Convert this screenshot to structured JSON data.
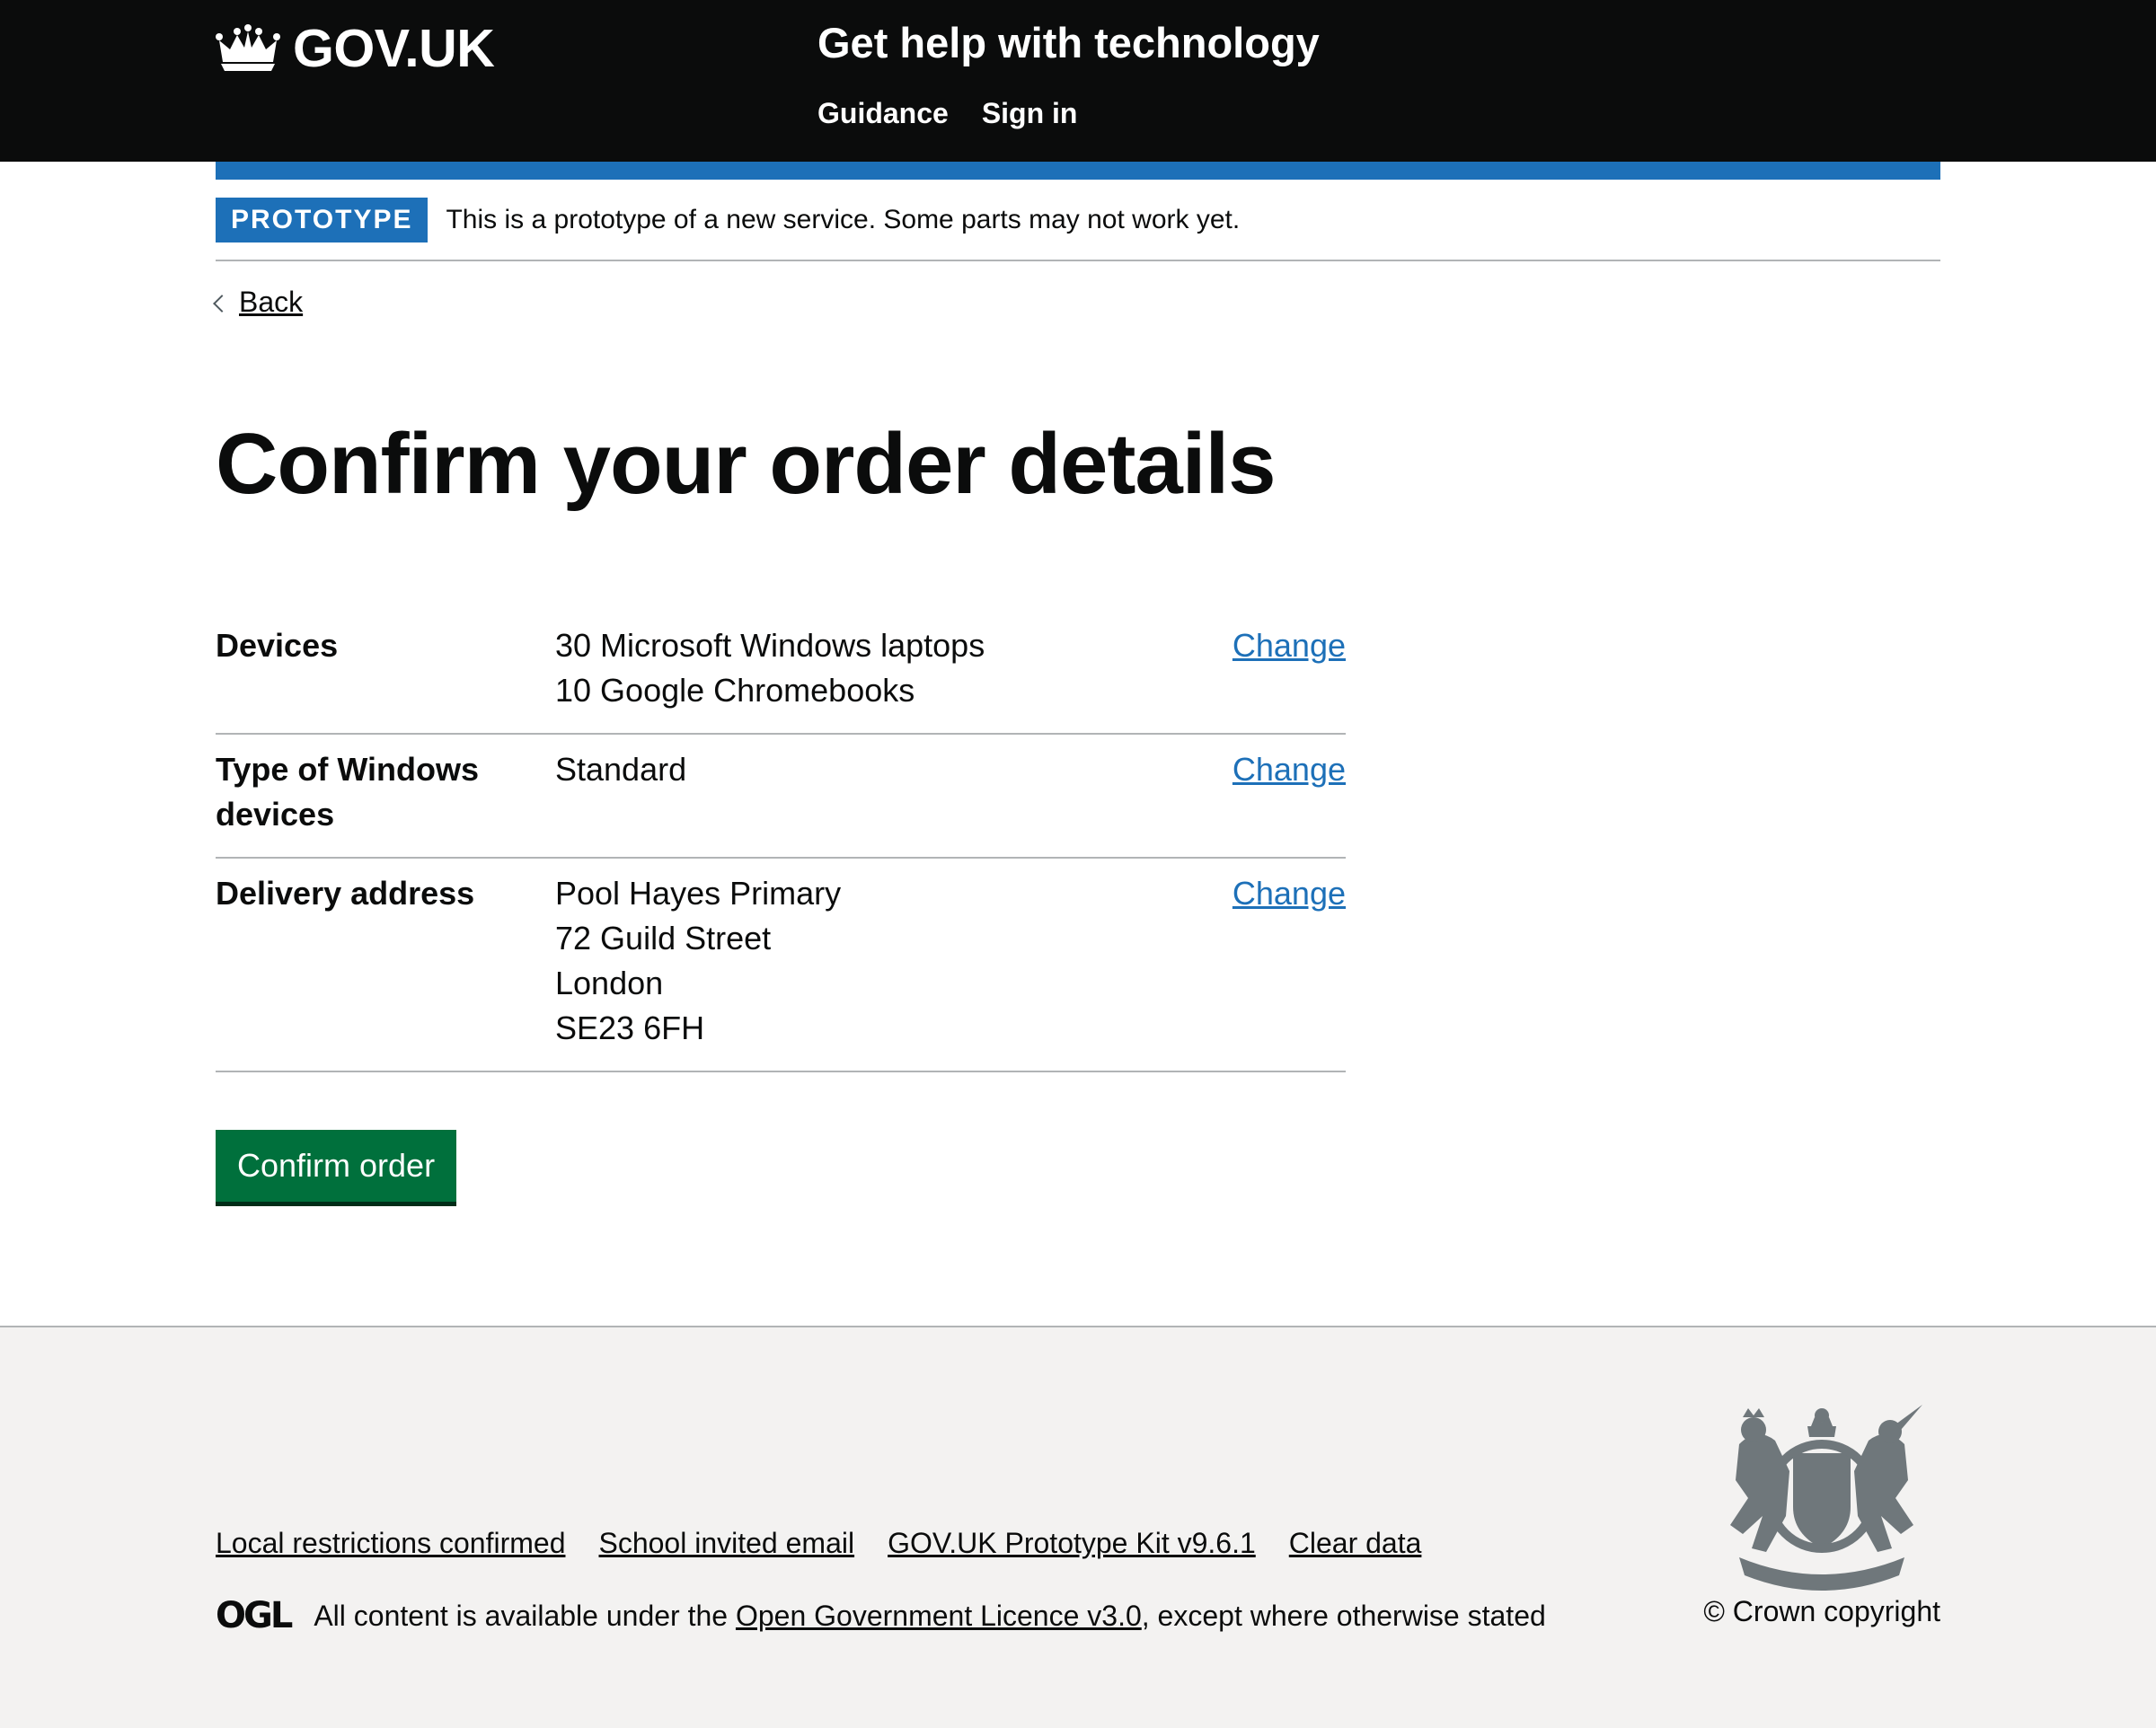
{
  "header": {
    "logo_text": "GOV.UK",
    "service_name": "Get help with technology",
    "nav": [
      {
        "label": "Guidance"
      },
      {
        "label": "Sign in"
      }
    ]
  },
  "phase_banner": {
    "tag": "PROTOTYPE",
    "text": "This is a prototype of a new service. Some parts may not work yet."
  },
  "back_link": "Back",
  "page_title": "Confirm your order details",
  "summary": [
    {
      "key": "Devices",
      "values": [
        "30 Microsoft Windows laptops",
        "10 Google Chromebooks"
      ],
      "action": "Change"
    },
    {
      "key": "Type of Windows devices",
      "values": [
        "Standard"
      ],
      "action": "Change"
    },
    {
      "key": "Delivery address",
      "values": [
        "Pool Hayes Primary",
        "72 Guild Street",
        "London",
        "SE23 6FH"
      ],
      "action": "Change"
    }
  ],
  "confirm_button": "Confirm order",
  "footer": {
    "links": [
      {
        "label": "Local restrictions confirmed"
      },
      {
        "label": "School invited email"
      },
      {
        "label": "GOV.UK Prototype Kit v9.6.1"
      },
      {
        "label": "Clear data"
      }
    ],
    "ogl_logo": "OGL",
    "licence_prefix": "All content is available under the ",
    "licence_link": "Open Government Licence v3.0",
    "licence_suffix": ", except where otherwise stated",
    "crest_icon": "royal-coat-of-arms-icon",
    "copyright": "© Crown copyright"
  },
  "colors": {
    "header_bg": "#0b0c0c",
    "brand_blue": "#1d70b8",
    "button_green": "#00703c",
    "footer_bg": "#f3f2f1",
    "link_blue": "#1d70b8"
  }
}
